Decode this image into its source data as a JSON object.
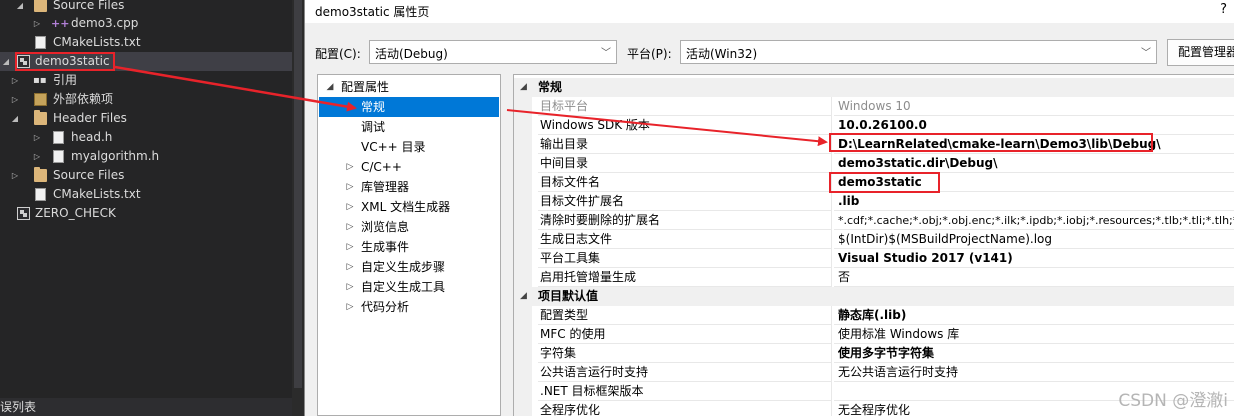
{
  "explorer": {
    "rows": [
      {
        "label": "Source Files"
      },
      {
        "label": "demo3.cpp"
      },
      {
        "label": "CMakeLists.txt"
      },
      {
        "label": "demo3static"
      },
      {
        "label": "引用"
      },
      {
        "label": "外部依赖项"
      },
      {
        "label": "Header Files"
      },
      {
        "label": "head.h"
      },
      {
        "label": "myalgorithm.h"
      },
      {
        "label": "Source Files"
      },
      {
        "label": "CMakeLists.txt"
      },
      {
        "label": "ZERO_CHECK"
      }
    ],
    "bottom_tab": "误列表"
  },
  "dialog": {
    "title": "demo3static 属性页",
    "help": "?",
    "config_label": "配置(C):",
    "config_value": "活动(Debug)",
    "platform_label": "平台(P):",
    "platform_value": "活动(Win32)",
    "manager_button": "配置管理器",
    "tree": {
      "root": "配置属性",
      "items": [
        {
          "label": "常规"
        },
        {
          "label": "调试"
        },
        {
          "label": "VC++ 目录"
        },
        {
          "label": "C/C++"
        },
        {
          "label": "库管理器"
        },
        {
          "label": "XML 文档生成器"
        },
        {
          "label": "浏览信息"
        },
        {
          "label": "生成事件"
        },
        {
          "label": "自定义生成步骤"
        },
        {
          "label": "自定义生成工具"
        },
        {
          "label": "代码分析"
        }
      ]
    },
    "sections": [
      {
        "title": "常规",
        "props": [
          {
            "name": "目标平台",
            "value": "Windows 10"
          },
          {
            "name": "Windows SDK 版本",
            "value": "10.0.26100.0"
          },
          {
            "name": "输出目录",
            "value": "D:\\LearnRelated\\cmake-learn\\Demo3\\lib\\Debug\\"
          },
          {
            "name": "中间目录",
            "value": "demo3static.dir\\Debug\\"
          },
          {
            "name": "目标文件名",
            "value": "demo3static"
          },
          {
            "name": "目标文件扩展名",
            "value": ".lib"
          },
          {
            "name": "清除时要删除的扩展名",
            "value": "*.cdf;*.cache;*.obj;*.obj.enc;*.ilk;*.ipdb;*.iobj;*.resources;*.tlb;*.tli;*.tlh;*."
          },
          {
            "name": "生成日志文件",
            "value": "$(IntDir)$(MSBuildProjectName).log"
          },
          {
            "name": "平台工具集",
            "value": "Visual Studio 2017 (v141)"
          },
          {
            "name": "启用托管增量生成",
            "value": "否"
          }
        ]
      },
      {
        "title": "项目默认值",
        "props": [
          {
            "name": "配置类型",
            "value": "静态库(.lib)"
          },
          {
            "name": "MFC 的使用",
            "value": "使用标准 Windows 库"
          },
          {
            "name": "字符集",
            "value": "使用多字节字符集"
          },
          {
            "name": "公共语言运行时支持",
            "value": "无公共语言运行时支持"
          },
          {
            "name": ".NET 目标框架版本",
            "value": ""
          },
          {
            "name": "全程序优化",
            "value": "无全程序优化"
          }
        ]
      }
    ]
  },
  "watermark": "CSDN @澄澈i",
  "colors": {
    "annotation": "#e8232a",
    "selection": "#0078d7"
  }
}
